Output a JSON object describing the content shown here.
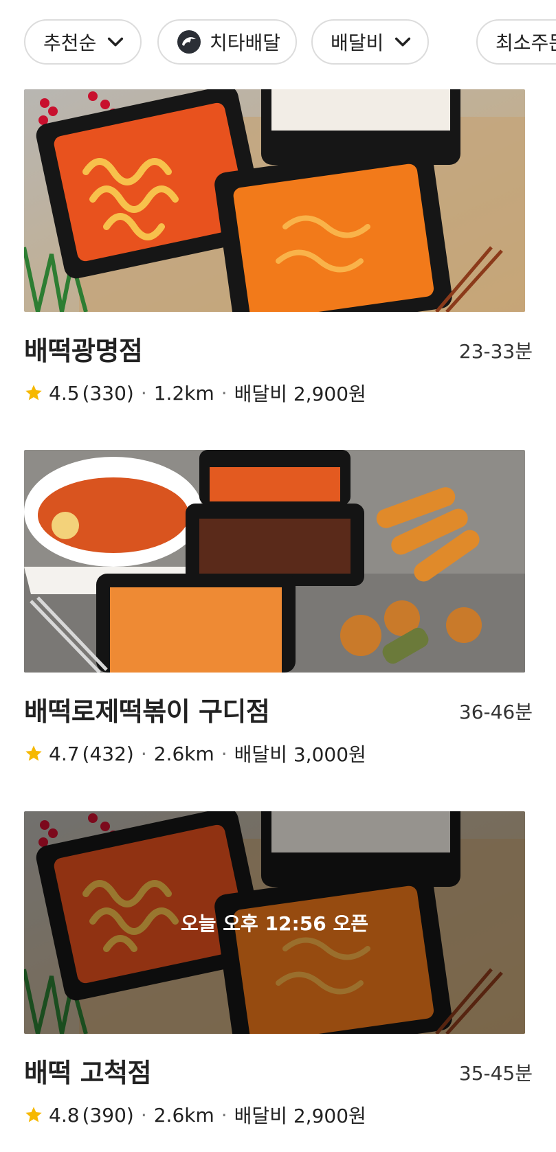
{
  "filters": [
    {
      "label": "추천순",
      "has_chevron": true
    },
    {
      "label": "치타배달",
      "icon": "cheetah-icon"
    },
    {
      "label": "배달비",
      "has_chevron": true
    },
    {
      "label": "최소주문"
    }
  ],
  "stores": [
    {
      "name": "배떡광명점",
      "eta": "23-33분",
      "rating": "4.5",
      "reviews": "(330)",
      "distance": "1.2km",
      "delivery_fee": "배달비 2,900원",
      "status_overlay": ""
    },
    {
      "name": "배떡로제떡볶이 구디점",
      "eta": "36-46분",
      "rating": "4.7",
      "reviews": "(432)",
      "distance": "2.6km",
      "delivery_fee": "배달비 3,000원",
      "status_overlay": ""
    },
    {
      "name": "배떡 고척점",
      "eta": "35-45분",
      "rating": "4.8",
      "reviews": "(390)",
      "distance": "2.6km",
      "delivery_fee": "배달비 2,900원",
      "status_overlay": "오늘 오후 12:56 오픈"
    }
  ],
  "colors": {
    "star": "#f6b800",
    "chip_border": "#dcdcdc",
    "text": "#222222"
  }
}
